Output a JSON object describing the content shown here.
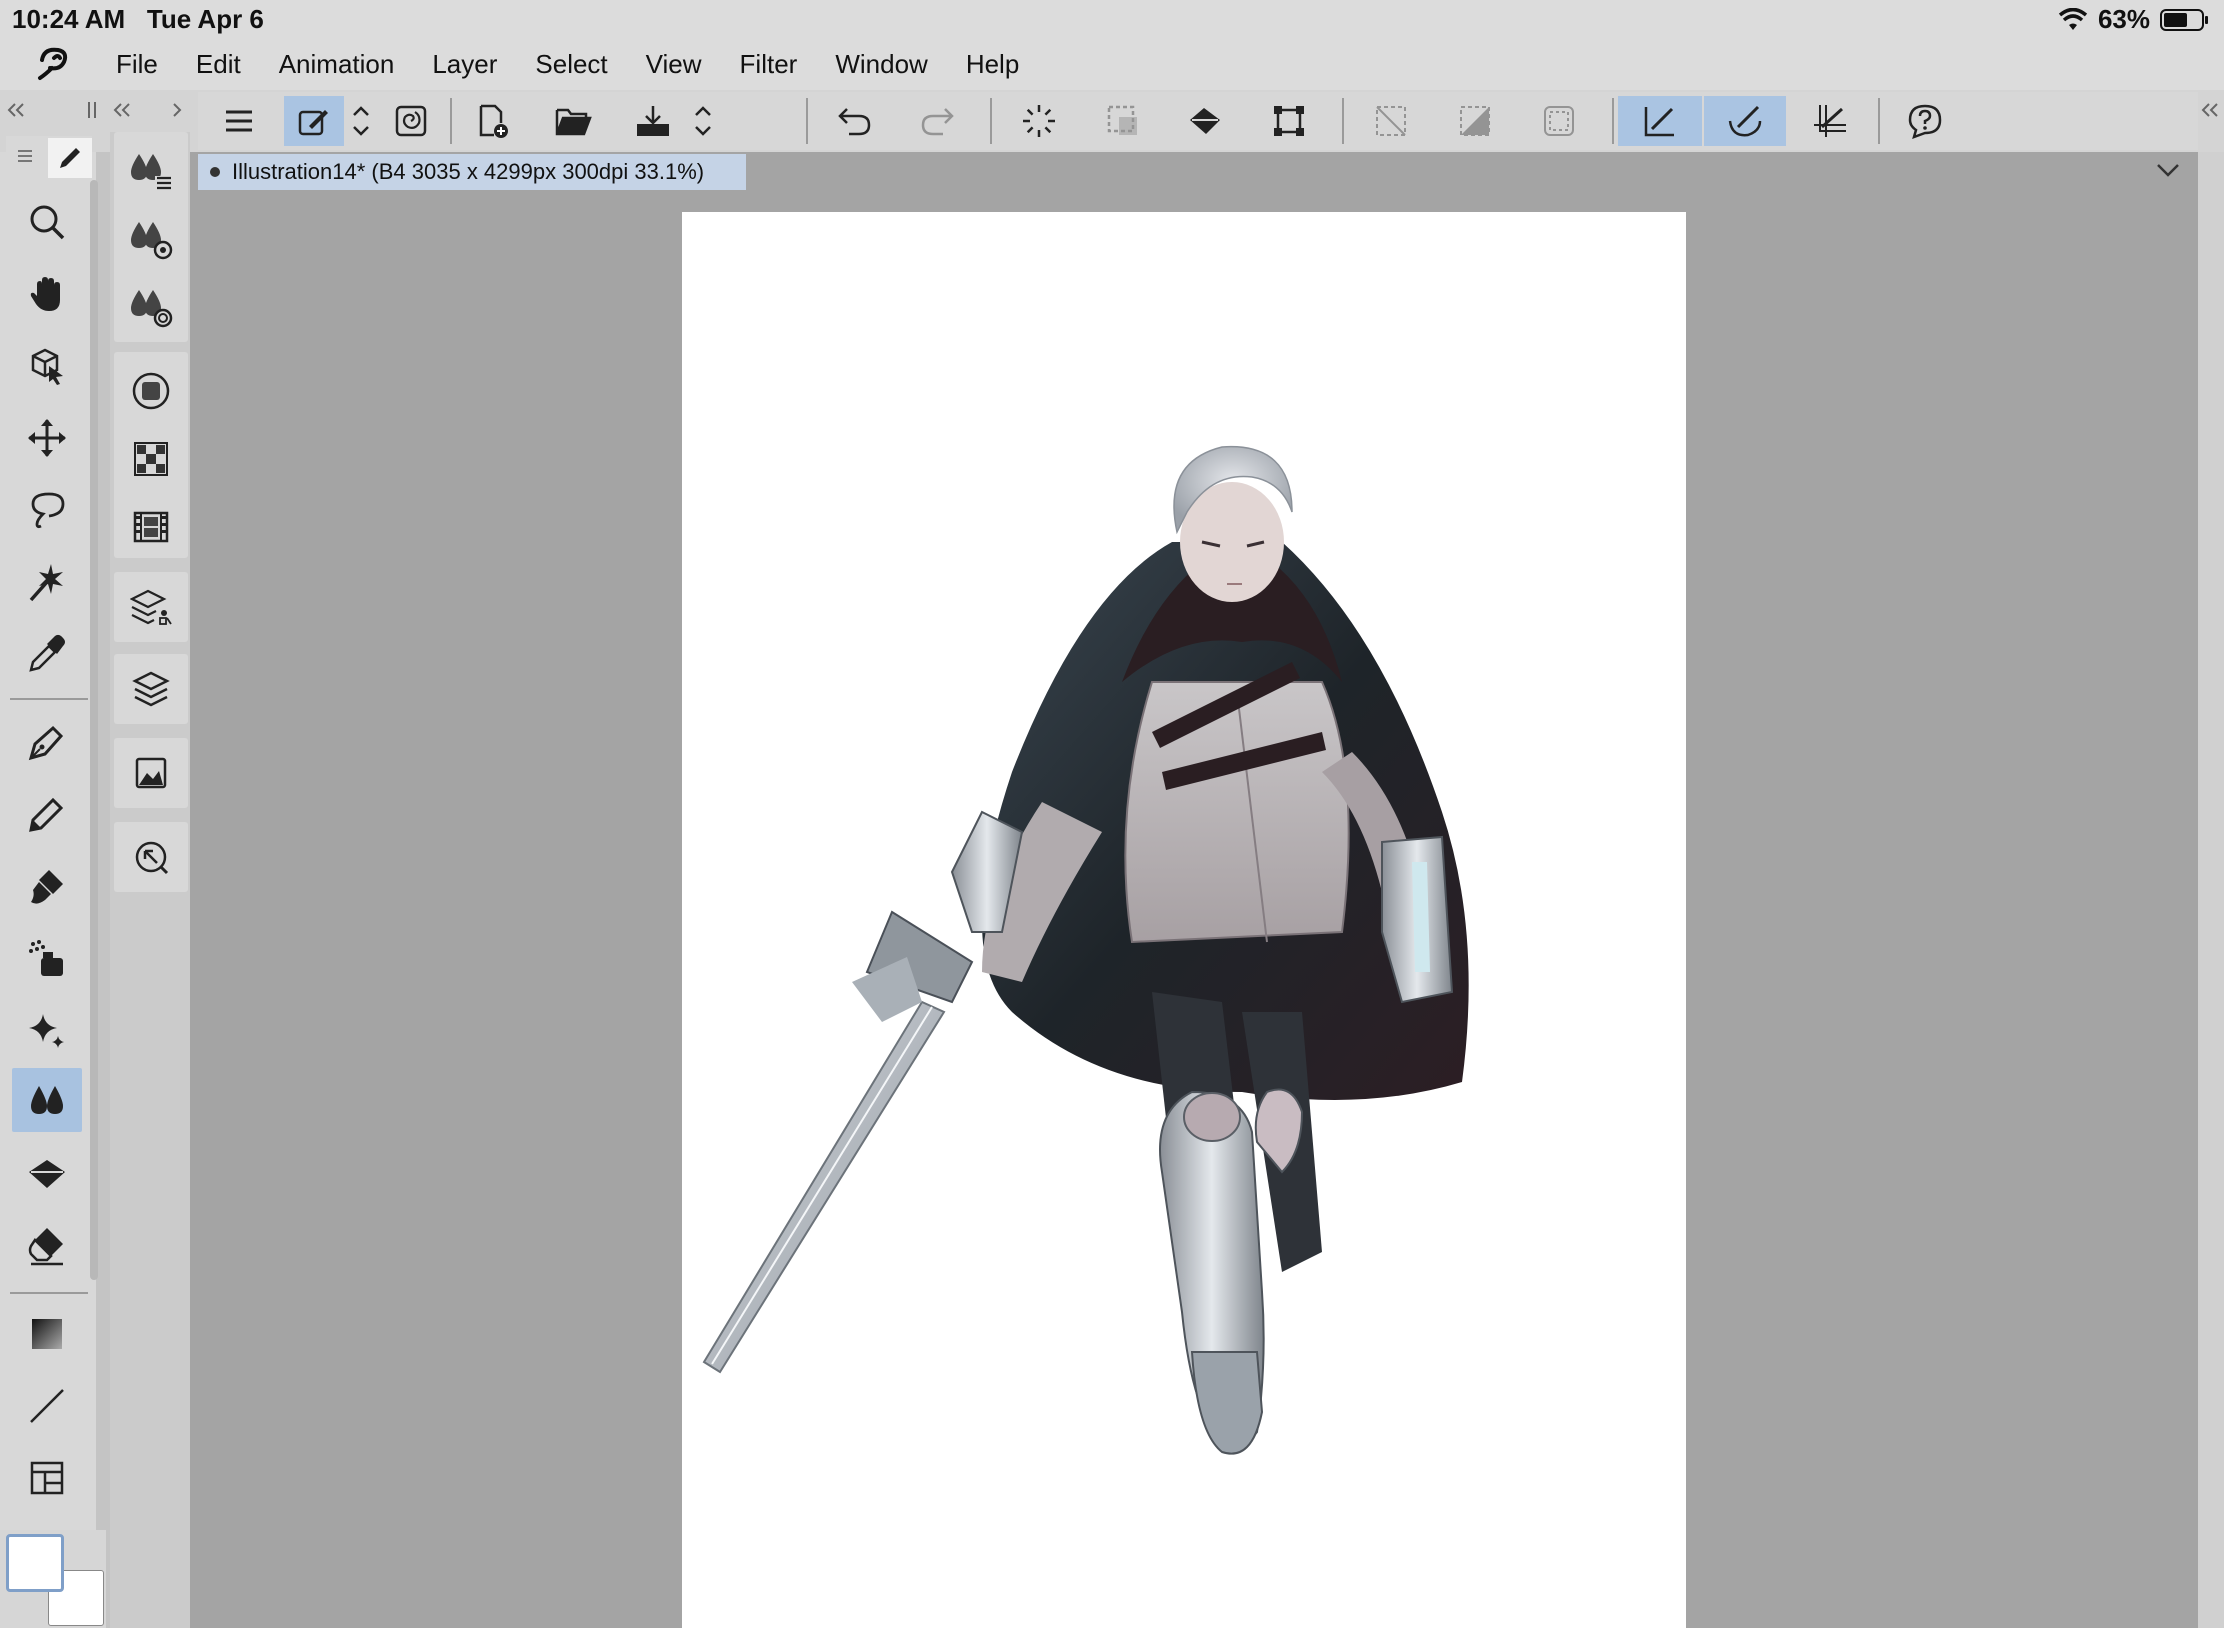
{
  "status": {
    "time": "10:24 AM",
    "date": "Tue Apr 6",
    "battery": "63%",
    "battery_level": 0.63,
    "wifi_icon": "wifi-icon"
  },
  "menu": {
    "items": [
      "File",
      "Edit",
      "Animation",
      "Layer",
      "Select",
      "View",
      "Filter",
      "Window",
      "Help"
    ]
  },
  "document": {
    "tab_title": "Illustration14* (B4 3035 x 4299px 300dpi 33.1%)"
  },
  "toolbar": {
    "icons": [
      "menu-icon",
      "sub-tool-icon",
      "up-down-chevron-icon",
      "spiral-icon",
      "new-file-icon",
      "open-folder-icon",
      "save-download-icon",
      "up-down-chevron-icon",
      "undo-icon",
      "redo-icon",
      "loading-spinner-icon",
      "select-dotted-icon",
      "fill-bucket-icon",
      "transform-icon",
      "deselect-icon",
      "invert-selection-icon",
      "crop-selection-icon",
      "snap-ruler-icon",
      "snap-curve-icon",
      "snap-grid-icon",
      "help-icon"
    ],
    "selected": [
      "sub-tool-icon",
      "snap-ruler-icon",
      "snap-curve-icon"
    ]
  },
  "tools": {
    "items": [
      "zoom-icon",
      "hand-icon",
      "3d-object-icon",
      "move-icon",
      "lasso-icon",
      "magic-wand-icon",
      "eyedropper-icon",
      "pen-icon",
      "pencil-icon",
      "brush-icon",
      "airbrush-icon",
      "decoration-icon",
      "blend-icon",
      "fill-icon",
      "eraser-icon",
      "gradient-icon",
      "line-icon",
      "frame-icon"
    ],
    "selected": "blend-icon"
  },
  "palettes": {
    "items": [
      "blend-list-icon",
      "blend-settings-icon",
      "blend-target-icon",
      "color-circle-icon",
      "color-set-icon",
      "timeline-icon",
      "layer-property-icon",
      "layers-icon",
      "navigator-icon",
      "search-icon"
    ]
  },
  "colors": {
    "main": "#ffffff",
    "sub": "#ffffff",
    "accent": "#aac4e2"
  }
}
